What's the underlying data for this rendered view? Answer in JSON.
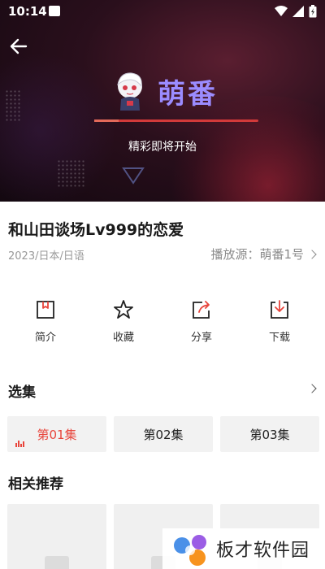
{
  "status_bar": {
    "time": "10:14"
  },
  "player": {
    "brand_name": "萌番",
    "loading_text": "精彩即将开始",
    "progress": 0.15
  },
  "video": {
    "title": "和山田谈场Lv999的恋爱",
    "meta": "2023/日本/日语",
    "source_label": "播放源：萌番1号"
  },
  "actions": [
    {
      "label": "简介",
      "icon": "bookmark-icon"
    },
    {
      "label": "收藏",
      "icon": "star-icon"
    },
    {
      "label": "分享",
      "icon": "share-icon"
    },
    {
      "label": "下载",
      "icon": "download-icon"
    }
  ],
  "episodes": {
    "section_title": "选集",
    "items": [
      {
        "label": "第01集",
        "active": true
      },
      {
        "label": "第02集",
        "active": false
      },
      {
        "label": "第03集",
        "active": false
      }
    ]
  },
  "recommendations": {
    "section_title": "相关推荐"
  },
  "watermark": {
    "text": "板才软件园"
  },
  "colors": {
    "accent": "#e8453c",
    "brand": "#9b8cff"
  }
}
